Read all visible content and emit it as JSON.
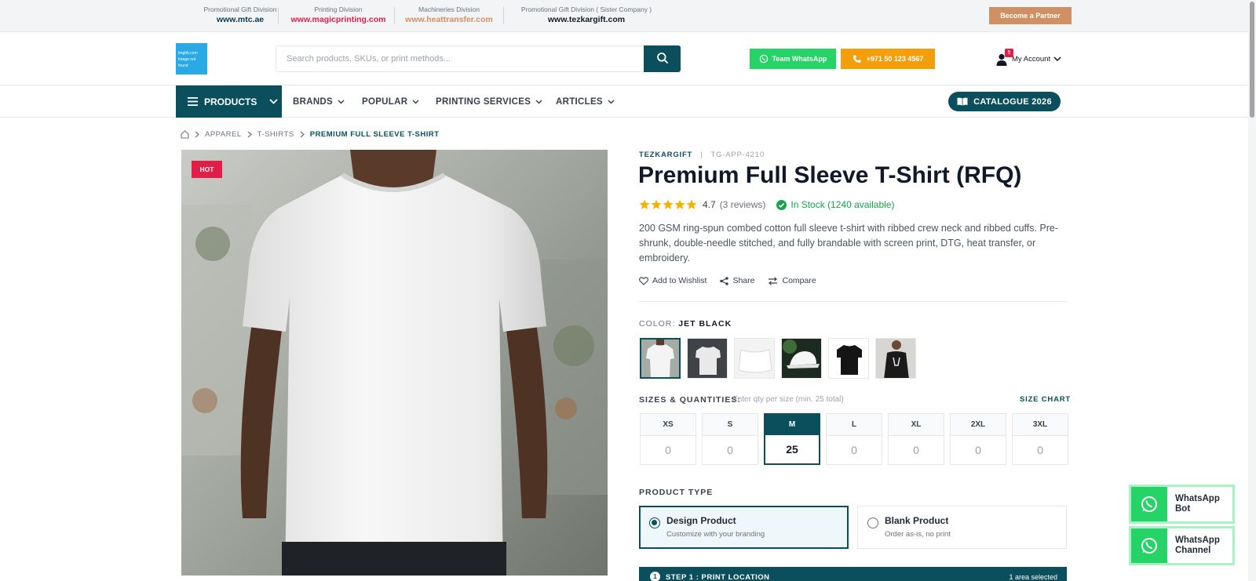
{
  "top_bar": {
    "divisions": [
      {
        "label": "Promotional Gift Division",
        "url": "www.mtc.ae",
        "color": "#0b3a4a"
      },
      {
        "label": "Printing Division",
        "url": "www.magicprinting.com",
        "color": "#e11d48"
      },
      {
        "label": "Machineries Division",
        "url": "www.heattransfer.com",
        "color": "#d19064"
      },
      {
        "label": "Promotional Gift Division ( Sister Company )",
        "url": "www.tezkargift.com",
        "color": "#111827"
      }
    ],
    "partner_button": "Become a Partner"
  },
  "header": {
    "logo_text": "Imghb.com Image not found",
    "search": {
      "placeholder": "Search products, SKUs, or print methods...",
      "value": ""
    },
    "whatsapp_button": "Team WhatsApp",
    "phone_button": "+971 50 123 4567",
    "cart_count": "5",
    "account_label": "My Account"
  },
  "nav": {
    "products": "PRODUCTS",
    "items": [
      "BRANDS",
      "POPULAR",
      "PRINTING SERVICES",
      "ARTICLES"
    ],
    "catalogue_button": "CATALOGUE 2026"
  },
  "breadcrumb": [
    "APPAREL",
    "T-SHIRTS",
    "PREMIUM FULL SLEEVE T-SHIRT"
  ],
  "product": {
    "badge": "HOT",
    "brand": "TEZKARGIFT",
    "separator": "|",
    "sku": "TG-APP-4210",
    "title": "Premium Full Sleeve T-Shirt (RFQ)",
    "rating": "4.7",
    "rating_stars": 5,
    "reviews": "(3 reviews)",
    "stock": "In Stock (1240 available)",
    "description": "200 GSM ring-spun combed cotton full sleeve t-shirt with ribbed crew neck and ribbed cuffs. Pre-shrunk, double-needle stitched, and fully brandable with screen print, DTG, heat transfer, or embroidery.",
    "actions": {
      "wishlist": "Add to Wishlist",
      "share": "Share",
      "compare": "Compare"
    },
    "color_label": "COLOR:",
    "color_value": "JET BLACK",
    "sizes_label": "SIZES & QUANTITIES:",
    "sizes_hint": "Enter qty per size (min. 25 total)",
    "size_chart": "SIZE CHART",
    "sizes": [
      {
        "size": "XS",
        "qty": "0"
      },
      {
        "size": "S",
        "qty": "0"
      },
      {
        "size": "M",
        "qty": "25"
      },
      {
        "size": "L",
        "qty": "0"
      },
      {
        "size": "XL",
        "qty": "0"
      },
      {
        "size": "2XL",
        "qty": "0"
      },
      {
        "size": "3XL",
        "qty": "0"
      }
    ],
    "product_type_label": "PRODUCT TYPE",
    "product_types": [
      {
        "title": "Design Product",
        "sub": "Customize with your branding"
      },
      {
        "title": "Blank Product",
        "sub": "Order as-is, no print"
      }
    ],
    "step": {
      "number": "1",
      "title": "STEP 1 : PRINT LOCATION",
      "count": "1 area selected"
    }
  },
  "floating": {
    "wa_bot": "WhatsApp Bot",
    "wa_channel": "WhatsApp Channel"
  },
  "colors": {
    "primary": "#0b4f5c",
    "whatsapp": "#25d366",
    "phone": "#f59e0b",
    "hot": "#e11d48",
    "stock": "#16a34a",
    "star": "#f5b301"
  }
}
